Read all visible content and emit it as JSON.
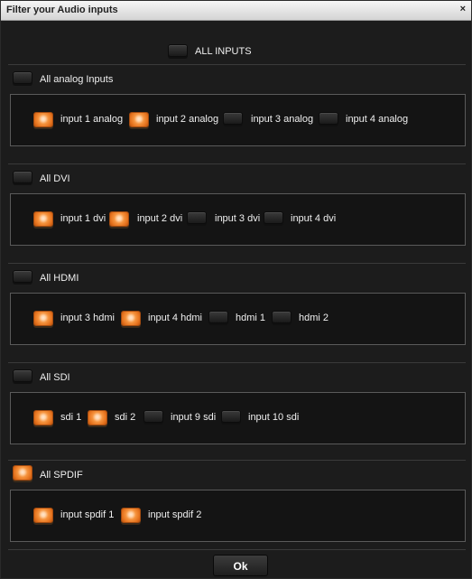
{
  "dialog": {
    "title": "Filter your Audio inputs",
    "close": "×"
  },
  "all_inputs": {
    "label": "ALL INPUTS",
    "checked": false
  },
  "groups": [
    {
      "label": "All analog Inputs",
      "checked": false,
      "items": [
        {
          "label": "input 1 analog",
          "checked": true
        },
        {
          "label": "input 2 analog",
          "checked": true
        },
        {
          "label": "input 3 analog",
          "checked": false
        },
        {
          "label": "input 4 analog",
          "checked": false
        }
      ]
    },
    {
      "label": "All DVI",
      "checked": false,
      "items": [
        {
          "label": "input 1 dvi",
          "checked": true
        },
        {
          "label": "input 2 dvi",
          "checked": true
        },
        {
          "label": "input 3 dvi",
          "checked": false
        },
        {
          "label": "input 4 dvi",
          "checked": false
        }
      ]
    },
    {
      "label": "All HDMI",
      "checked": false,
      "items": [
        {
          "label": "input 3 hdmi",
          "checked": true
        },
        {
          "label": "input 4 hdmi",
          "checked": true
        },
        {
          "label": "hdmi 1",
          "checked": false
        },
        {
          "label": "hdmi 2",
          "checked": false
        }
      ]
    },
    {
      "label": "All SDI",
      "checked": false,
      "items": [
        {
          "label": "sdi 1",
          "checked": true
        },
        {
          "label": "sdi 2",
          "checked": true
        },
        {
          "label": "input 9 sdi",
          "checked": false
        },
        {
          "label": "input 10 sdi",
          "checked": false
        }
      ]
    },
    {
      "label": "All SPDIF",
      "checked": true,
      "items": [
        {
          "label": "input spdif 1",
          "checked": true
        },
        {
          "label": "input spdif 2",
          "checked": true
        }
      ]
    }
  ],
  "ok_label": "Ok",
  "colors": {
    "toggle_on": "#f6943e",
    "toggle_off": "#2a2a2a",
    "background": "#1c1c1c",
    "panel_border": "#5a5a5a"
  }
}
